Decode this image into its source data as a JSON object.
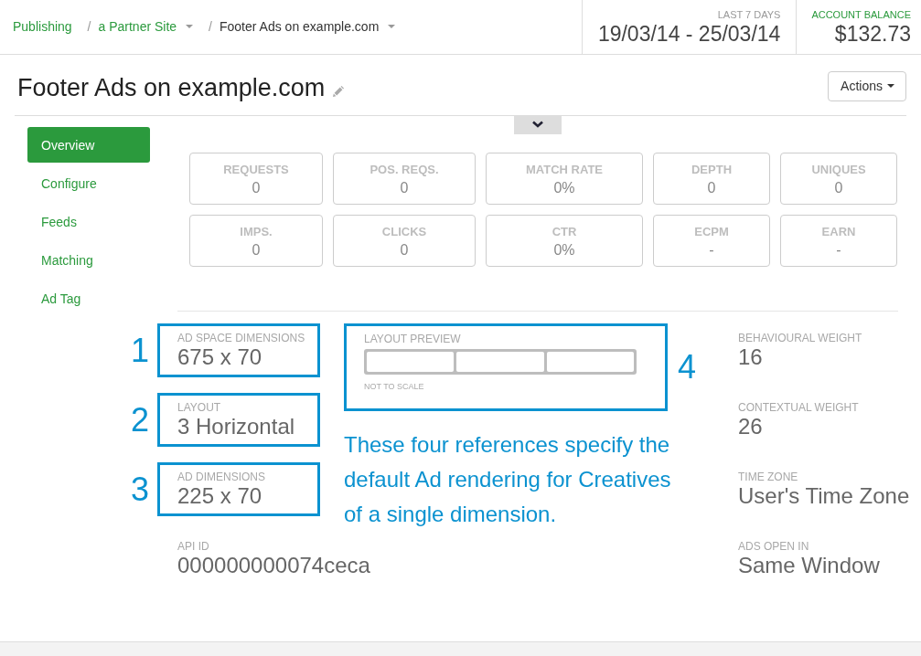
{
  "breadcrumbs": [
    {
      "label": "Publishing",
      "current": false,
      "dropdown": false
    },
    {
      "separator": "/",
      "label": "a Partner Site",
      "current": false,
      "dropdown": true
    },
    {
      "separator": "/",
      "label": "Footer Ads on example.com",
      "current": true,
      "dropdown": true
    }
  ],
  "date_range": {
    "label": "LAST 7 DAYS",
    "value": "19/03/14 - 25/03/14"
  },
  "account_balance": {
    "label": "ACCOUNT BALANCE",
    "value": "$132.73"
  },
  "page_header": {
    "title": "Footer Ads on example.com",
    "actions_button": "Actions"
  },
  "sidebar": {
    "items": [
      {
        "label": "Overview",
        "selected": true
      },
      {
        "label": "Configure",
        "selected": false
      },
      {
        "label": "Feeds",
        "selected": false
      },
      {
        "label": "Matching",
        "selected": false
      },
      {
        "label": "Ad Tag",
        "selected": false
      }
    ]
  },
  "stats": {
    "rows": [
      {
        "cells": [
          {
            "label": "REQUESTS",
            "value": "0"
          },
          {
            "label": "POS. REQS.",
            "value": "0"
          },
          {
            "label": "MATCH RATE",
            "value": "0%"
          },
          {
            "label": "DEPTH",
            "value": "0"
          },
          {
            "label": "UNIQUES",
            "value": "0"
          }
        ]
      },
      {
        "cells": [
          {
            "label": "IMPS.",
            "value": "0"
          },
          {
            "label": "CLICKS",
            "value": "0"
          },
          {
            "label": "CTR",
            "value": "0%"
          },
          {
            "label": "ECPM",
            "value": "-"
          },
          {
            "label": "EARN",
            "value": "-"
          }
        ]
      }
    ]
  },
  "details": {
    "fields": [
      {
        "label": "AD SPACE DIMENSIONS",
        "value": "675 x 70",
        "annotation": "1"
      },
      {
        "label": "LAYOUT",
        "value": "3 Horizontal",
        "annotation": "2"
      },
      {
        "label": "AD DIMENSIONS",
        "value": "225 x 70",
        "annotation": "3"
      },
      {
        "label": "API ID",
        "value": "000000000074ceca"
      }
    ],
    "layout_preview": {
      "label": "LAYOUT PREVIEW",
      "note": "NOT TO SCALE",
      "annotation": "4"
    },
    "annotation_note": "These four references specify the default Ad rendering for Creatives of a single dimension.",
    "settings": [
      {
        "label": "BEHAVIOURAL WEIGHT",
        "value": "16"
      },
      {
        "label": "CONTEXTUAL WEIGHT",
        "value": "26"
      },
      {
        "label": "TIME ZONE",
        "value": "User's Time Zone"
      },
      {
        "label": "ADS OPEN IN",
        "value": "Same Window"
      }
    ]
  }
}
